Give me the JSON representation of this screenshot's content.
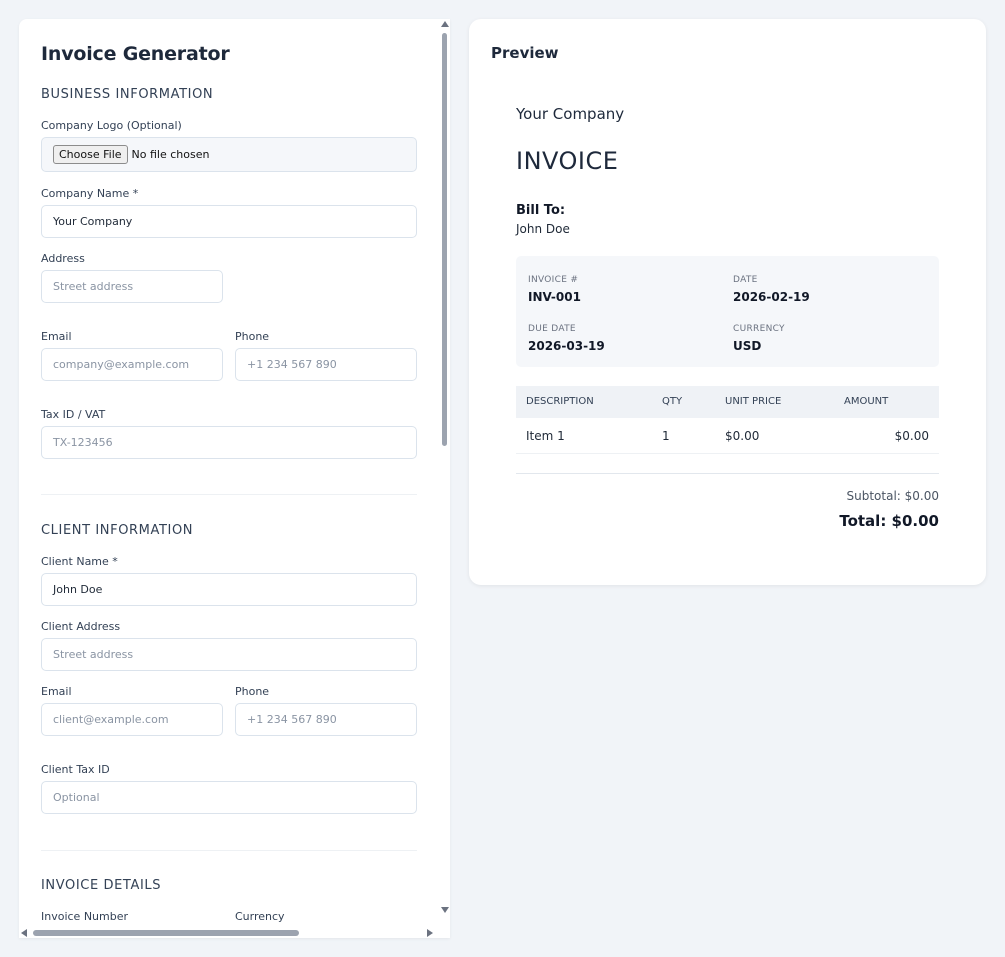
{
  "form": {
    "title": "Invoice Generator",
    "business": {
      "heading": "BUSINESS INFORMATION",
      "logo_label": "Company Logo (Optional)",
      "file_button": "Choose File",
      "file_status": "No file chosen",
      "company_name_label": "Company Name *",
      "company_name_value": "Your Company",
      "address_label": "Address",
      "address_placeholder": "Street address",
      "email_label": "Email",
      "email_placeholder": "company@example.com",
      "phone_label": "Phone",
      "phone_placeholder": "+1 234 567 890",
      "tax_label": "Tax ID / VAT",
      "tax_placeholder": "TX-123456"
    },
    "client": {
      "heading": "CLIENT INFORMATION",
      "name_label": "Client Name *",
      "name_value": "John Doe",
      "address_label": "Client Address",
      "address_placeholder": "Street address",
      "email_label": "Email",
      "email_placeholder": "client@example.com",
      "phone_label": "Phone",
      "phone_placeholder": "+1 234 567 890",
      "tax_label": "Client Tax ID",
      "tax_placeholder": "Optional"
    },
    "details": {
      "heading": "INVOICE DETAILS",
      "number_label": "Invoice Number",
      "currency_label": "Currency"
    }
  },
  "preview": {
    "title": "Preview",
    "company": "Your Company",
    "doc_title": "INVOICE",
    "bill_to_label": "Bill To:",
    "client_name": "John Doe",
    "meta": {
      "invoice_no_label": "INVOICE #",
      "invoice_no": "INV-001",
      "date_label": "DATE",
      "date": "2026-02-19",
      "due_label": "DUE DATE",
      "due": "2026-03-19",
      "currency_label": "CURRENCY",
      "currency": "USD"
    },
    "table": {
      "headers": [
        "DESCRIPTION",
        "QTY",
        "UNIT PRICE",
        "AMOUNT"
      ],
      "rows": [
        {
          "description": "Item 1",
          "qty": "1",
          "unit_price": "$0.00",
          "amount": "$0.00"
        }
      ]
    },
    "subtotal": "Subtotal: $0.00",
    "total": "Total: $0.00"
  },
  "icons": {
    "scroll_up": "triangle-up",
    "scroll_down": "triangle-down",
    "scroll_left": "triangle-left",
    "scroll_right": "triangle-right"
  }
}
